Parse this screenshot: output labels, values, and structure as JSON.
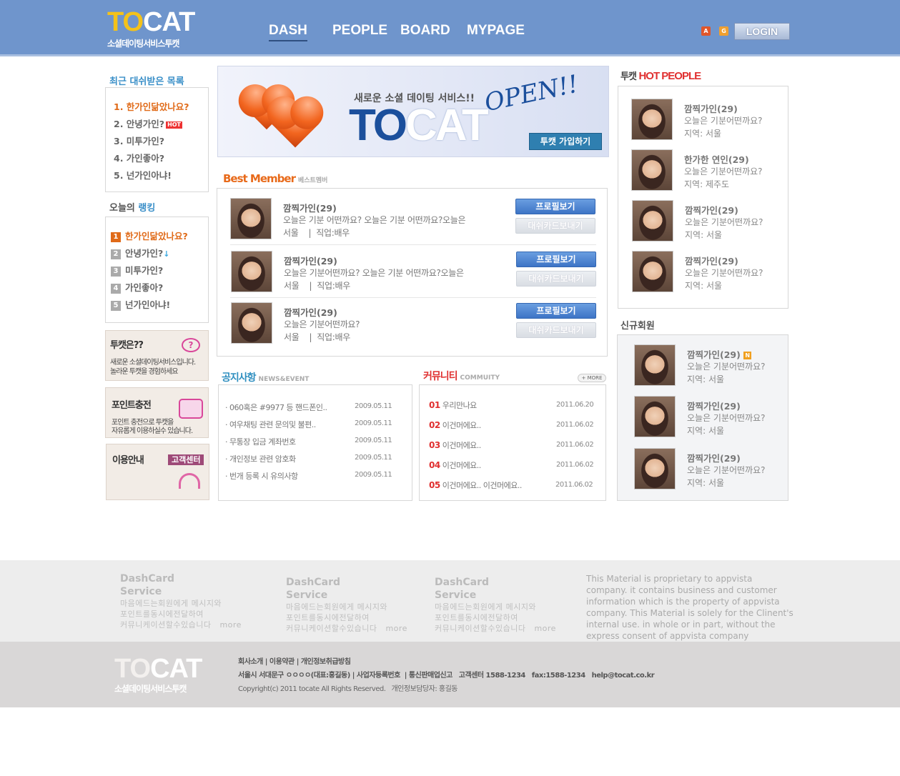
{
  "header": {
    "logo_to": "TO",
    "logo_cat": "CAT",
    "logo_sub": "소셜데이팅서비스투캣",
    "nav": [
      "DASH",
      "PEOPLE",
      "BOARD",
      "MYPAGE"
    ],
    "icon_a": "A",
    "icon_g": "G",
    "login": "LOGIN"
  },
  "left": {
    "recent_title": "최근 대쉬받은 목록",
    "recent": [
      "1. 한가인닮았나요?",
      "2. 안녕가인?",
      "3. 미투가인?",
      "4. 가인좋아?",
      "5. 넌가인아냐!"
    ],
    "hot_badge": "HOT",
    "rank_title_a": "오늘의 ",
    "rank_title_b": "랭킹",
    "ranking": [
      {
        "n": "1",
        "t": "한가인닮았나요?"
      },
      {
        "n": "2",
        "t": "안녕가인?"
      },
      {
        "n": "3",
        "t": "미투가인?"
      },
      {
        "n": "4",
        "t": "가인좋아?"
      },
      {
        "n": "5",
        "t": "넌가인아냐!"
      }
    ],
    "promo1_title": "투캣은??",
    "promo1_text1": "새로운 소셜데이팅서비스입니다.",
    "promo1_text2": "놀라운 투캣을 경험하세요",
    "promo2_title": "포인트충전",
    "promo2_text1": "포인트 충전으로 투캣을",
    "promo2_text2": "자유롭게 이용하실수 있습니다.",
    "promo3_title": "이용안내",
    "promo3_badge": "고객센터"
  },
  "banner": {
    "sub": "새로운 소셜 데이팅 서비스!!",
    "title_a": "TO",
    "title_b": "CAT",
    "open": "OPEN!!",
    "button": "투캣 가입하기"
  },
  "best": {
    "title": "Best Member",
    "title_sub": "베스트멤버",
    "profile_btn": "프로필보기",
    "card_btn": "대쉬카드보내기",
    "members": [
      {
        "name": "깜찍가인(29)",
        "text": "오늘은 기분 어떤까요? 오늘은 기분 어떤까요?오늘은",
        "meta": "서울    |  직업:배우"
      },
      {
        "name": "깜찍가인(29)",
        "text": "오늘은 기분어떤까요? 오늘은 기분 어떤까요?오늘은",
        "meta": "서울    |  직업:배우"
      },
      {
        "name": "깜찍가인(29)",
        "text": "오늘은 기분어떤까요?",
        "meta": "서울    |  직업:배우"
      }
    ]
  },
  "notice": {
    "title": "공지사항",
    "title_sub": "NEWS&EVENT",
    "rows": [
      {
        "t": "· 060혹은 #9977 등 핸드폰인..",
        "d": "2009.05.11"
      },
      {
        "t": "· 여우채팅 관련 문의및 불편..",
        "d": "2009.05.11"
      },
      {
        "t": "· 무통장 입금 계좌번호",
        "d": "2009.05.11"
      },
      {
        "t": "· 개인정보 관련 암호화",
        "d": "2009.05.11"
      },
      {
        "t": "· 번개 등록 시 유의사항",
        "d": "2009.05.11"
      }
    ]
  },
  "community": {
    "title": "커뮤니티",
    "title_sub": "COMMUITY",
    "more": "+ MORE",
    "rows": [
      {
        "n": "01",
        "t": "우리만나요",
        "d": "2011.06.20"
      },
      {
        "n": "02",
        "t": "이건머에요..",
        "d": "2011.06.02"
      },
      {
        "n": "03",
        "t": "이건머에요..",
        "d": "2011.06.02"
      },
      {
        "n": "04",
        "t": "이건머에요..",
        "d": "2011.06.02"
      },
      {
        "n": "05",
        "t": "이건머에요.. 이건머에요..",
        "d": "2011.06.02"
      }
    ]
  },
  "right": {
    "hot_title_a": "투캣 ",
    "hot_title_b": "HOT PEOPLE",
    "hot": [
      {
        "name": "깜찍가인(29)",
        "text": "오늘은 기분어떤까요?",
        "area": "지역: 서울"
      },
      {
        "name": "한가한 연인(29)",
        "text": "오늘은 기분어떤까요?",
        "area": "지역: 제주도"
      },
      {
        "name": "깜찍가인(29)",
        "text": "오늘은 기분어떤까요?",
        "area": "지역: 서울"
      },
      {
        "name": "깜찍가인(29)",
        "text": "오늘은 기분어떤까요?",
        "area": "지역: 서울"
      }
    ],
    "new_title": "신규회원",
    "new_badge": "N",
    "new": [
      {
        "name": "깜찍가인(29)",
        "text": "오늘은 기분어떤까요?",
        "area": "지역: 서울"
      },
      {
        "name": "깜찍가인(29)",
        "text": "오늘은 기분어떤까요?",
        "area": "지역: 서울"
      },
      {
        "name": "깜찍가인(29)",
        "text": "오늘은 기분어떤까요?",
        "area": "지역: 서울"
      }
    ]
  },
  "footer": {
    "col_title1": "DashCard",
    "col_title2": "Service",
    "col_l1": "마음에드는회원에게 메시지와",
    "col_l2": "포인트를동시에전달하여",
    "col_l3": "커뮤니케이션할수있습니다",
    "more": "more",
    "legal": "This Material is proprietary to appvista company. it contains business and customer information which is the property of appvista company. This Material is solely for the Clinent's internal use. in whole or in part, without the express consent of appvista company",
    "logo_to": "TO",
    "logo_cat": "CAT",
    "logo_sub": "소셜데이팅서비스투캣",
    "links": "회사소개 | 이용약관 | 개인정보취급방침",
    "address": "서울시 서대문구 ㅇㅇㅇㅇ(대표:홍길동) | 사업자등록번호  | 통신판매업신고   고객센터 1588-1234   fax:1588-1234   help@tocat.co.kr",
    "copyright": "Copyright(c) 2011 tocate All Rights Reserved.   개인정보담당자: 홍길동"
  }
}
